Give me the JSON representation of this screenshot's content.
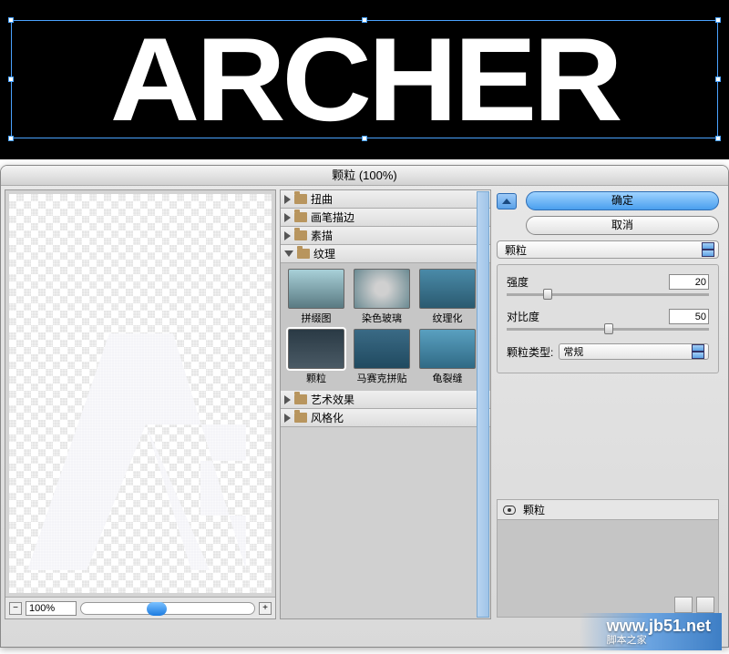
{
  "canvas": {
    "text": "ARCHER"
  },
  "dialog": {
    "title": "颗粒 (100%)",
    "preview_zoom": "100%",
    "categories": {
      "distort": "扭曲",
      "brush": "画笔描边",
      "sketch": "素描",
      "texture": "纹理",
      "artistic": "艺术效果",
      "stylize": "风格化"
    },
    "thumbs": {
      "patchwork": "拼缀图",
      "stained": "染色玻璃",
      "texturizer": "纹理化",
      "grain": "颗粒",
      "mosaic": "马赛克拼贴",
      "craquelure": "龟裂缝"
    }
  },
  "controls": {
    "ok": "确定",
    "cancel": "取消",
    "filter_name": "颗粒",
    "intensity_label": "强度",
    "intensity_value": "20",
    "contrast_label": "对比度",
    "contrast_value": "50",
    "grain_type_label": "颗粒类型:",
    "grain_type_value": "常规"
  },
  "layer": {
    "name": "颗粒"
  },
  "watermark": {
    "site": "www.jb51.net",
    "cn": "脚本之家"
  }
}
